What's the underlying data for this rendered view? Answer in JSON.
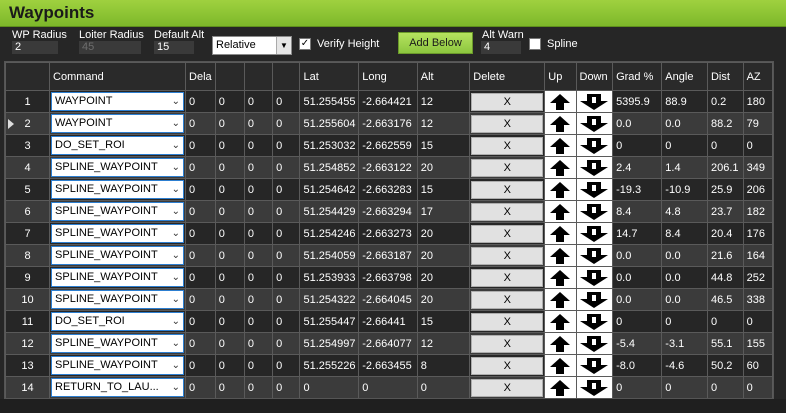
{
  "panel": {
    "title": "Waypoints"
  },
  "toolbar": {
    "wp_radius_label": "WP Radius",
    "wp_radius_value": "2",
    "loiter_radius_label": "Loiter Radius",
    "loiter_radius_value": "45",
    "default_alt_label": "Default Alt",
    "default_alt_value": "15",
    "alt_mode_value": "Relative",
    "verify_height_label": "Verify Height",
    "verify_height_checked": true,
    "add_below_label": "Add Below",
    "alt_warn_label": "Alt Warn",
    "alt_warn_value": "4",
    "spline_label": "Spline",
    "spline_checked": false
  },
  "grid": {
    "columns": [
      "Command",
      "Dela",
      "",
      "",
      "",
      "Lat",
      "Long",
      "Alt",
      "Delete",
      "Up",
      "Down",
      "Grad %",
      "Angle",
      "Dist",
      "AZ"
    ],
    "delete_label": "X",
    "current_row": 2,
    "rows": [
      {
        "num": "1",
        "command": "WAYPOINT",
        "p1": "0",
        "p2": "0",
        "p3": "0",
        "p4": "0",
        "lat": "51.255455",
        "lng": "-2.664421",
        "alt": "12",
        "grad": "5395.9",
        "angle": "88.9",
        "dist": "0.2",
        "az": "180"
      },
      {
        "num": "2",
        "command": "WAYPOINT",
        "p1": "0",
        "p2": "0",
        "p3": "0",
        "p4": "0",
        "lat": "51.255604",
        "lng": "-2.663176",
        "alt": "12",
        "grad": "0.0",
        "angle": "0.0",
        "dist": "88.2",
        "az": "79"
      },
      {
        "num": "3",
        "command": "DO_SET_ROI",
        "p1": "0",
        "p2": "0",
        "p3": "0",
        "p4": "0",
        "lat": "51.253032",
        "lng": "-2.662559",
        "alt": "15",
        "grad": "0",
        "angle": "0",
        "dist": "0",
        "az": "0"
      },
      {
        "num": "4",
        "command": "SPLINE_WAYPOINT",
        "p1": "0",
        "p2": "0",
        "p3": "0",
        "p4": "0",
        "lat": "51.254852",
        "lng": "-2.663122",
        "alt": "20",
        "grad": "2.4",
        "angle": "1.4",
        "dist": "206.1",
        "az": "349"
      },
      {
        "num": "5",
        "command": "SPLINE_WAYPOINT",
        "p1": "0",
        "p2": "0",
        "p3": "0",
        "p4": "0",
        "lat": "51.254642",
        "lng": "-2.663283",
        "alt": "15",
        "grad": "-19.3",
        "angle": "-10.9",
        "dist": "25.9",
        "az": "206"
      },
      {
        "num": "6",
        "command": "SPLINE_WAYPOINT",
        "p1": "0",
        "p2": "0",
        "p3": "0",
        "p4": "0",
        "lat": "51.254429",
        "lng": "-2.663294",
        "alt": "17",
        "grad": "8.4",
        "angle": "4.8",
        "dist": "23.7",
        "az": "182"
      },
      {
        "num": "7",
        "command": "SPLINE_WAYPOINT",
        "p1": "0",
        "p2": "0",
        "p3": "0",
        "p4": "0",
        "lat": "51.254246",
        "lng": "-2.663273",
        "alt": "20",
        "grad": "14.7",
        "angle": "8.4",
        "dist": "20.4",
        "az": "176"
      },
      {
        "num": "8",
        "command": "SPLINE_WAYPOINT",
        "p1": "0",
        "p2": "0",
        "p3": "0",
        "p4": "0",
        "lat": "51.254059",
        "lng": "-2.663187",
        "alt": "20",
        "grad": "0.0",
        "angle": "0.0",
        "dist": "21.6",
        "az": "164"
      },
      {
        "num": "9",
        "command": "SPLINE_WAYPOINT",
        "p1": "0",
        "p2": "0",
        "p3": "0",
        "p4": "0",
        "lat": "51.253933",
        "lng": "-2.663798",
        "alt": "20",
        "grad": "0.0",
        "angle": "0.0",
        "dist": "44.8",
        "az": "252"
      },
      {
        "num": "10",
        "command": "SPLINE_WAYPOINT",
        "p1": "0",
        "p2": "0",
        "p3": "0",
        "p4": "0",
        "lat": "51.254322",
        "lng": "-2.664045",
        "alt": "20",
        "grad": "0.0",
        "angle": "0.0",
        "dist": "46.5",
        "az": "338"
      },
      {
        "num": "11",
        "command": "DO_SET_ROI",
        "p1": "0",
        "p2": "0",
        "p3": "0",
        "p4": "0",
        "lat": "51.255447",
        "lng": "-2.66441",
        "alt": "15",
        "grad": "0",
        "angle": "0",
        "dist": "0",
        "az": "0"
      },
      {
        "num": "12",
        "command": "SPLINE_WAYPOINT",
        "p1": "0",
        "p2": "0",
        "p3": "0",
        "p4": "0",
        "lat": "51.254997",
        "lng": "-2.664077",
        "alt": "12",
        "grad": "-5.4",
        "angle": "-3.1",
        "dist": "55.1",
        "az": "155"
      },
      {
        "num": "13",
        "command": "SPLINE_WAYPOINT",
        "p1": "0",
        "p2": "0",
        "p3": "0",
        "p4": "0",
        "lat": "51.255226",
        "lng": "-2.663455",
        "alt": "8",
        "grad": "-8.0",
        "angle": "-4.6",
        "dist": "50.2",
        "az": "60"
      },
      {
        "num": "14",
        "command": "RETURN_TO_LAU...",
        "p1": "0",
        "p2": "0",
        "p3": "0",
        "p4": "0",
        "lat": "0",
        "lng": "0",
        "alt": "0",
        "grad": "0",
        "angle": "0",
        "dist": "0",
        "az": "0"
      }
    ]
  }
}
